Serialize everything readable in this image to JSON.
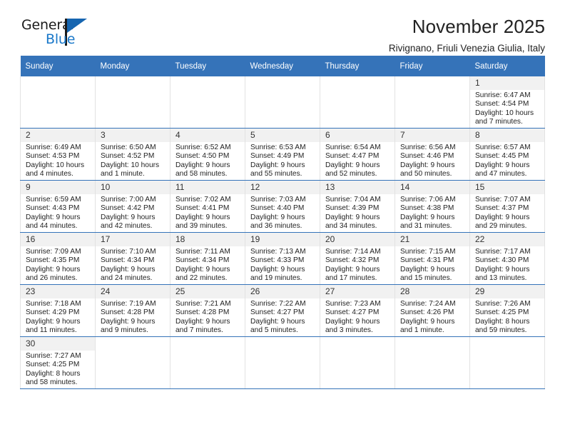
{
  "brand": {
    "name_top": "General",
    "name_bottom": "Blue",
    "accent_color": "#1877c9",
    "flag_color": "#1665b0"
  },
  "header": {
    "title": "November 2025",
    "subtitle": "Rivignano, Friuli Venezia Giulia, Italy"
  },
  "calendar": {
    "header_bg": "#3573b9",
    "weekdays": [
      "Sunday",
      "Monday",
      "Tuesday",
      "Wednesday",
      "Thursday",
      "Friday",
      "Saturday"
    ],
    "labels": {
      "sunrise": "Sunrise:",
      "sunset": "Sunset:",
      "daylight": "Daylight:"
    },
    "weeks": [
      [
        {
          "empty": true
        },
        {
          "empty": true
        },
        {
          "empty": true
        },
        {
          "empty": true
        },
        {
          "empty": true
        },
        {
          "empty": true
        },
        {
          "day": "1",
          "sunrise": "Sunrise: 6:47 AM",
          "sunset": "Sunset: 4:54 PM",
          "daylight": "Daylight: 10 hours and 7 minutes."
        }
      ],
      [
        {
          "day": "2",
          "sunrise": "Sunrise: 6:49 AM",
          "sunset": "Sunset: 4:53 PM",
          "daylight": "Daylight: 10 hours and 4 minutes."
        },
        {
          "day": "3",
          "sunrise": "Sunrise: 6:50 AM",
          "sunset": "Sunset: 4:52 PM",
          "daylight": "Daylight: 10 hours and 1 minute."
        },
        {
          "day": "4",
          "sunrise": "Sunrise: 6:52 AM",
          "sunset": "Sunset: 4:50 PM",
          "daylight": "Daylight: 9 hours and 58 minutes."
        },
        {
          "day": "5",
          "sunrise": "Sunrise: 6:53 AM",
          "sunset": "Sunset: 4:49 PM",
          "daylight": "Daylight: 9 hours and 55 minutes."
        },
        {
          "day": "6",
          "sunrise": "Sunrise: 6:54 AM",
          "sunset": "Sunset: 4:47 PM",
          "daylight": "Daylight: 9 hours and 52 minutes."
        },
        {
          "day": "7",
          "sunrise": "Sunrise: 6:56 AM",
          "sunset": "Sunset: 4:46 PM",
          "daylight": "Daylight: 9 hours and 50 minutes."
        },
        {
          "day": "8",
          "sunrise": "Sunrise: 6:57 AM",
          "sunset": "Sunset: 4:45 PM",
          "daylight": "Daylight: 9 hours and 47 minutes."
        }
      ],
      [
        {
          "day": "9",
          "sunrise": "Sunrise: 6:59 AM",
          "sunset": "Sunset: 4:43 PM",
          "daylight": "Daylight: 9 hours and 44 minutes."
        },
        {
          "day": "10",
          "sunrise": "Sunrise: 7:00 AM",
          "sunset": "Sunset: 4:42 PM",
          "daylight": "Daylight: 9 hours and 42 minutes."
        },
        {
          "day": "11",
          "sunrise": "Sunrise: 7:02 AM",
          "sunset": "Sunset: 4:41 PM",
          "daylight": "Daylight: 9 hours and 39 minutes."
        },
        {
          "day": "12",
          "sunrise": "Sunrise: 7:03 AM",
          "sunset": "Sunset: 4:40 PM",
          "daylight": "Daylight: 9 hours and 36 minutes."
        },
        {
          "day": "13",
          "sunrise": "Sunrise: 7:04 AM",
          "sunset": "Sunset: 4:39 PM",
          "daylight": "Daylight: 9 hours and 34 minutes."
        },
        {
          "day": "14",
          "sunrise": "Sunrise: 7:06 AM",
          "sunset": "Sunset: 4:38 PM",
          "daylight": "Daylight: 9 hours and 31 minutes."
        },
        {
          "day": "15",
          "sunrise": "Sunrise: 7:07 AM",
          "sunset": "Sunset: 4:37 PM",
          "daylight": "Daylight: 9 hours and 29 minutes."
        }
      ],
      [
        {
          "day": "16",
          "sunrise": "Sunrise: 7:09 AM",
          "sunset": "Sunset: 4:35 PM",
          "daylight": "Daylight: 9 hours and 26 minutes."
        },
        {
          "day": "17",
          "sunrise": "Sunrise: 7:10 AM",
          "sunset": "Sunset: 4:34 PM",
          "daylight": "Daylight: 9 hours and 24 minutes."
        },
        {
          "day": "18",
          "sunrise": "Sunrise: 7:11 AM",
          "sunset": "Sunset: 4:34 PM",
          "daylight": "Daylight: 9 hours and 22 minutes."
        },
        {
          "day": "19",
          "sunrise": "Sunrise: 7:13 AM",
          "sunset": "Sunset: 4:33 PM",
          "daylight": "Daylight: 9 hours and 19 minutes."
        },
        {
          "day": "20",
          "sunrise": "Sunrise: 7:14 AM",
          "sunset": "Sunset: 4:32 PM",
          "daylight": "Daylight: 9 hours and 17 minutes."
        },
        {
          "day": "21",
          "sunrise": "Sunrise: 7:15 AM",
          "sunset": "Sunset: 4:31 PM",
          "daylight": "Daylight: 9 hours and 15 minutes."
        },
        {
          "day": "22",
          "sunrise": "Sunrise: 7:17 AM",
          "sunset": "Sunset: 4:30 PM",
          "daylight": "Daylight: 9 hours and 13 minutes."
        }
      ],
      [
        {
          "day": "23",
          "sunrise": "Sunrise: 7:18 AM",
          "sunset": "Sunset: 4:29 PM",
          "daylight": "Daylight: 9 hours and 11 minutes."
        },
        {
          "day": "24",
          "sunrise": "Sunrise: 7:19 AM",
          "sunset": "Sunset: 4:28 PM",
          "daylight": "Daylight: 9 hours and 9 minutes."
        },
        {
          "day": "25",
          "sunrise": "Sunrise: 7:21 AM",
          "sunset": "Sunset: 4:28 PM",
          "daylight": "Daylight: 9 hours and 7 minutes."
        },
        {
          "day": "26",
          "sunrise": "Sunrise: 7:22 AM",
          "sunset": "Sunset: 4:27 PM",
          "daylight": "Daylight: 9 hours and 5 minutes."
        },
        {
          "day": "27",
          "sunrise": "Sunrise: 7:23 AM",
          "sunset": "Sunset: 4:27 PM",
          "daylight": "Daylight: 9 hours and 3 minutes."
        },
        {
          "day": "28",
          "sunrise": "Sunrise: 7:24 AM",
          "sunset": "Sunset: 4:26 PM",
          "daylight": "Daylight: 9 hours and 1 minute."
        },
        {
          "day": "29",
          "sunrise": "Sunrise: 7:26 AM",
          "sunset": "Sunset: 4:25 PM",
          "daylight": "Daylight: 8 hours and 59 minutes."
        }
      ],
      [
        {
          "day": "30",
          "sunrise": "Sunrise: 7:27 AM",
          "sunset": "Sunset: 4:25 PM",
          "daylight": "Daylight: 8 hours and 58 minutes."
        },
        {
          "empty": true
        },
        {
          "empty": true
        },
        {
          "empty": true
        },
        {
          "empty": true
        },
        {
          "empty": true
        },
        {
          "empty": true
        }
      ]
    ]
  }
}
